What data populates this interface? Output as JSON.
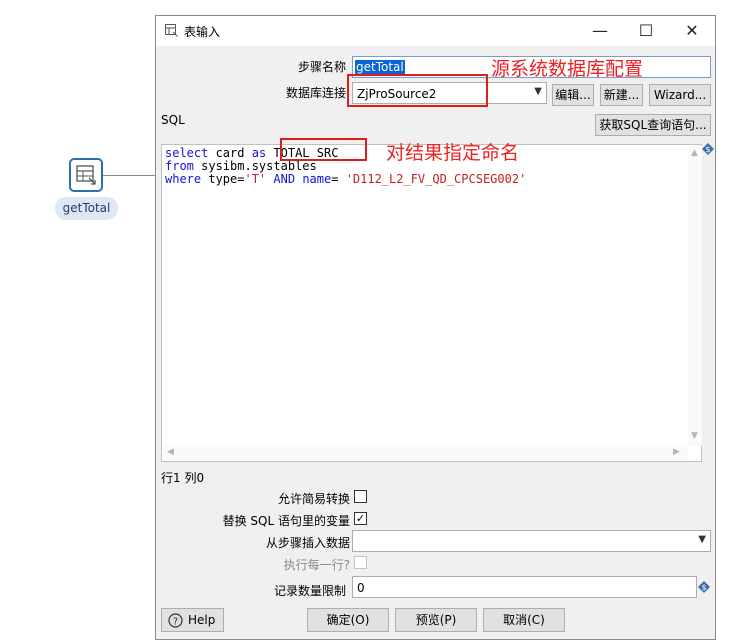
{
  "canvas": {
    "step_label": "getTotal",
    "step_icon": "table-input-icon"
  },
  "dialog": {
    "title": "表输入",
    "title_icon": "table-input-icon",
    "minimize": "—",
    "maximize": "☐",
    "close": "✕",
    "step_name_label": "步骤名称",
    "step_name_value": "getTotal",
    "db_conn_label": "数据库连接",
    "db_conn_value": "ZjProSource2",
    "edit_button": "编辑...",
    "new_button": "新建...",
    "wizard_button": "Wizard...",
    "sql_label": "SQL",
    "get_sql_button": "获取SQL查询语句...",
    "sql": {
      "l1_kw1": "select",
      "l1_p1": " card ",
      "l1_kw2": "as",
      "l1_p2": " TOTAL_SRC",
      "l2_kw": "from",
      "l2_p": " sysibm.systables",
      "l3_kw1": "where",
      "l3_p1": " type=",
      "l3_s1": "'T'",
      "l3_p2": " ",
      "l3_kw2": "AND",
      "l3_p3": " ",
      "l3_kw3": "name",
      "l3_p4": "= ",
      "l3_s2": "'D112_L2_FV_QD_CPCSEG002'"
    },
    "cursor_pos": "行1 列0",
    "lazy_conversion_label": "允许简易转换",
    "lazy_conversion_checked": false,
    "replace_vars_label": "替换 SQL 语句里的变量",
    "replace_vars_checked": true,
    "insert_from_step_label": "从步骤插入数据",
    "insert_from_step_value": "",
    "execute_each_row_label": "执行每一行?",
    "execute_each_row_checked": false,
    "limit_label": "记录数量限制",
    "limit_value": "0",
    "help_button": "Help",
    "ok_button": "确定(O)",
    "preview_button": "预览(P)",
    "cancel_button": "取消(C)"
  },
  "annotations": {
    "db_config_note": "源系统数据库配置",
    "result_name_note": "对结果指定命名",
    "color": "#e21b1b"
  }
}
